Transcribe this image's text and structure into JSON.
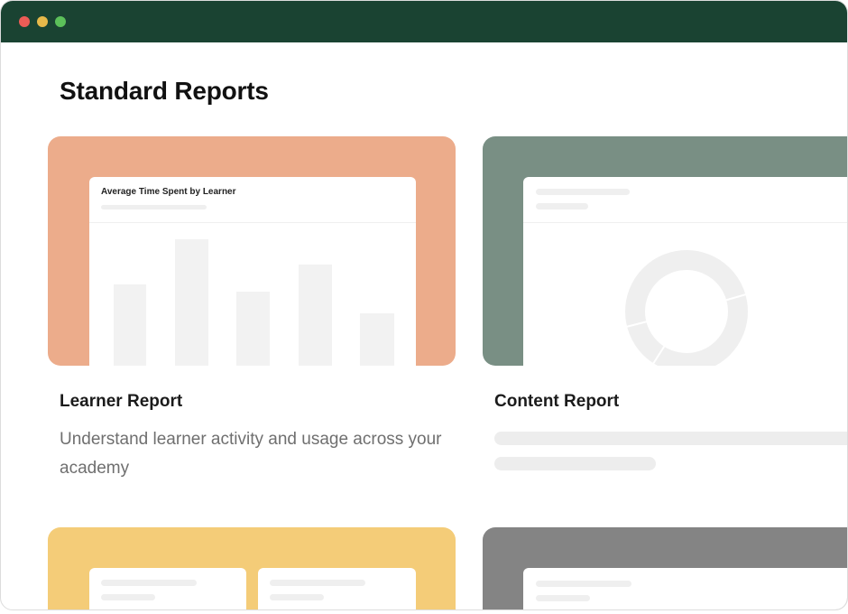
{
  "page": {
    "title": "Standard Reports"
  },
  "window": {
    "controls": [
      "close",
      "minimize",
      "maximize"
    ],
    "titlebar_color": "#1a4332"
  },
  "cards": [
    {
      "title": "Learner Report",
      "description": "Understand learner activity and usage across your academy",
      "banner_color": "#ecac8b",
      "preview": {
        "chart_title": "Average Time Spent by Learner"
      }
    },
    {
      "title": "Content Report",
      "description": "",
      "banner_color": "#798f84"
    },
    {
      "title": "",
      "banner_color": "#f4cc78"
    },
    {
      "title": "",
      "banner_color": "#848484"
    }
  ]
}
